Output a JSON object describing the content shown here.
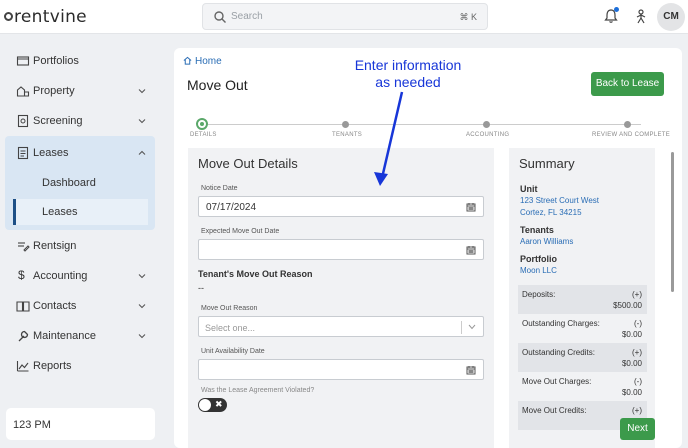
{
  "app": {
    "logo_text": "rentvine"
  },
  "header": {
    "search_placeholder": "Search",
    "search_shortcut": "⌘ K",
    "avatar_initials": "CM",
    "icons": [
      "search-icon",
      "bell-icon",
      "person-icon"
    ],
    "notification_color": "#1e6fd9"
  },
  "sidebar": {
    "items": [
      {
        "label": "Portfolios",
        "icon": "portfolio-icon",
        "has_chevron": false
      },
      {
        "label": "Property",
        "icon": "property-icon",
        "has_chevron": true
      },
      {
        "label": "Screening",
        "icon": "screening-icon",
        "has_chevron": true
      },
      {
        "label": "Leases",
        "icon": "leases-icon",
        "has_chevron": true,
        "expanded": true
      },
      {
        "label": "Rentsign",
        "icon": "rentsign-icon",
        "has_chevron": false
      },
      {
        "label": "Accounting",
        "icon": "dollar-icon",
        "has_chevron": true
      },
      {
        "label": "Contacts",
        "icon": "contacts-icon",
        "has_chevron": true
      },
      {
        "label": "Maintenance",
        "icon": "wrench-icon",
        "has_chevron": true
      },
      {
        "label": "Reports",
        "icon": "reports-icon",
        "has_chevron": false
      }
    ],
    "leases_sub": [
      {
        "label": "Dashboard",
        "active": false
      },
      {
        "label": "Leases",
        "active": true
      }
    ],
    "account_label": "123 PM"
  },
  "main": {
    "breadcrumb": "Home",
    "title": "Move Out",
    "back_button": "Back to Lease",
    "steps": [
      {
        "label": "DETAILS",
        "active": true
      },
      {
        "label": "TENANTS",
        "active": false
      },
      {
        "label": "ACCOUNTING",
        "active": false
      },
      {
        "label": "REVIEW AND COMPLETE",
        "active": false
      }
    ],
    "form": {
      "title": "Move Out Details",
      "notice_date_label": "Notice Date",
      "notice_date_value": "07/17/2024",
      "expected_label": "Expected Move Out Date",
      "expected_value": "",
      "reason_heading": "Tenant's Move Out Reason",
      "reason_value": "--",
      "reason_select_label": "Move Out Reason",
      "reason_select_placeholder": "Select one...",
      "availability_label": "Unit Availability Date",
      "availability_value": "",
      "violated_label": "Was the Lease Agreement Violated?",
      "violated_on": false
    },
    "summary": {
      "title": "Summary",
      "unit_heading": "Unit",
      "unit_line1": "123 Street Court West",
      "unit_line2": "Cortez, FL 34215",
      "tenants_heading": "Tenants",
      "tenant_name": "Aaron Williams",
      "portfolio_heading": "Portfolio",
      "portfolio_name": "Moon LLC",
      "rows": [
        {
          "label": "Deposits:",
          "sign": "(+)",
          "value": "$500.00"
        },
        {
          "label": "Outstanding Charges:",
          "sign": "(-)",
          "value": "$0.00"
        },
        {
          "label": "Outstanding Credits:",
          "sign": "(+)",
          "value": "$0.00"
        },
        {
          "label": "Move Out Charges:",
          "sign": "(-)",
          "value": "$0.00"
        },
        {
          "label": "Move Out Credits:",
          "sign": "(+)",
          "value": ""
        }
      ]
    },
    "next_button": "Next",
    "accent_green": "#3c9a4b",
    "link_blue": "#2a6db5"
  },
  "annotation": {
    "line1": "Enter information",
    "line2": "as needed",
    "color": "#1736d8"
  }
}
